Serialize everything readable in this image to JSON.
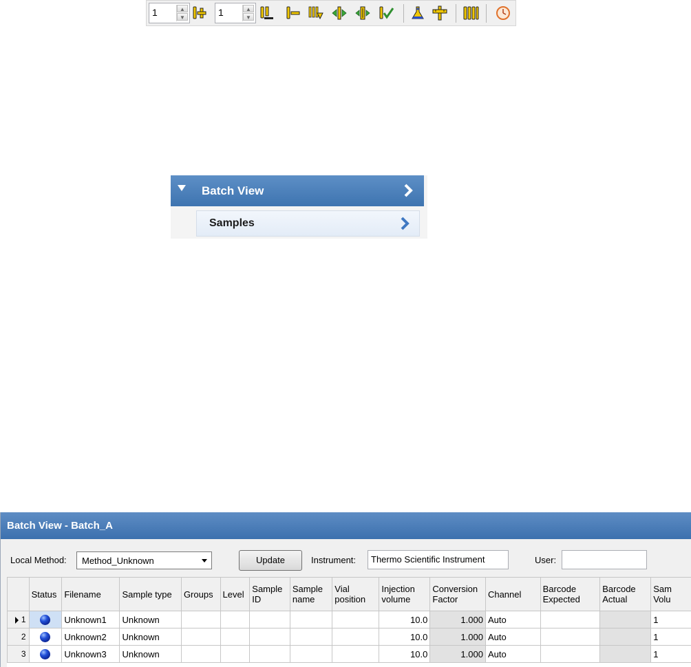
{
  "toolbar": {
    "spin1_value": "1",
    "spin2_value": "1",
    "icons": [
      "insert-samples-icon",
      "add-rows-icon",
      "insert-row-icon",
      "remove-row-icon",
      "fill-down-icon",
      "move-row-right-icon",
      "move-row-icon",
      "check-rows-icon",
      "flask-icon",
      "ruler-icon",
      "vials-icon",
      "clock-icon"
    ],
    "icon_color": "#f2c800"
  },
  "nav": {
    "header_title": "Batch View",
    "item_label": "Samples",
    "header_color": "#4a7fbc"
  },
  "batch": {
    "title": "Batch View - Batch_A",
    "local_method_label": "Local Method:",
    "local_method_value": "Method_Unknown",
    "update_label": "Update",
    "instrument_label": "Instrument:",
    "instrument_value": "Thermo Scientific Instrument",
    "user_label": "User:",
    "user_value": "",
    "columns": [
      "Status",
      "Filename",
      "Sample type",
      "Groups",
      "Level",
      "Sample ID",
      "Sample name",
      "Vial position",
      "Injection volume",
      "Conversion Factor",
      "Channel",
      "Barcode Expected",
      "Barcode Actual",
      "Sam Volu"
    ],
    "rows": [
      {
        "index": "1",
        "filename": "Unknown1",
        "sample_type": "Unknown",
        "groups": "",
        "level": "",
        "sample_id": "",
        "sample_name": "",
        "vial_position": "",
        "injection_volume": "10.0",
        "conversion_factor": "1.000",
        "channel": "Auto",
        "barcode_expected": "",
        "barcode_actual": "",
        "sample_volume": "1"
      },
      {
        "index": "2",
        "filename": "Unknown2",
        "sample_type": "Unknown",
        "groups": "",
        "level": "",
        "sample_id": "",
        "sample_name": "",
        "vial_position": "",
        "injection_volume": "10.0",
        "conversion_factor": "1.000",
        "channel": "Auto",
        "barcode_expected": "",
        "barcode_actual": "",
        "sample_volume": "1"
      },
      {
        "index": "3",
        "filename": "Unknown3",
        "sample_type": "Unknown",
        "groups": "",
        "level": "",
        "sample_id": "",
        "sample_name": "",
        "vial_position": "",
        "injection_volume": "10.0",
        "conversion_factor": "1.000",
        "channel": "Auto",
        "barcode_expected": "",
        "barcode_actual": "",
        "sample_volume": "1"
      }
    ]
  }
}
